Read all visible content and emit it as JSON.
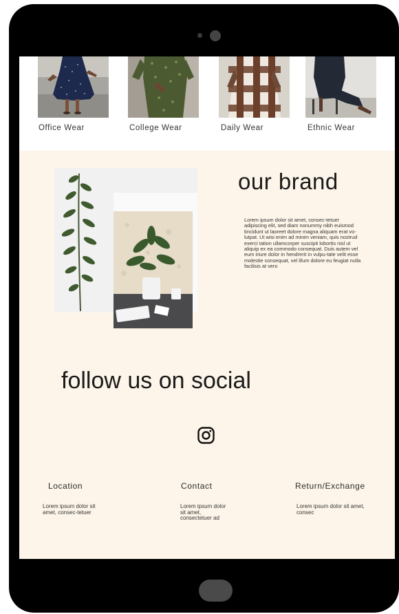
{
  "categories": [
    {
      "label": "Office Wear"
    },
    {
      "label": "College Wear"
    },
    {
      "label": "Daily Wear"
    },
    {
      "label": "Ethnic Wear"
    }
  ],
  "brand": {
    "title": "our brand",
    "body": "Lorem ipsum dolor sit amet, consec-tetuer adipiscing elit, sed diam nonummy nibh euismod tincidunt ut laoreet dolore magna aliquam erat vo-lutpat. Ut wisi enim ad minim veniam, quis nostrud exerci tation ullamcorper suscipit lobortis nisl ut aliquip ex ea commodo consequat. Duis autem vel eum iriure dolor in hendrerit in vulpu-tate velit esse molestie consequat, vel illum dolore eu feugiat nulla facilisis at vero"
  },
  "social": {
    "title": "follow us on social",
    "icon": "instagram-icon"
  },
  "footer": [
    {
      "heading": "Location",
      "text": "Lorem ipsum dolor sit amet, consec-tetuer"
    },
    {
      "heading": "Contact",
      "text": "Lorem ipsum dolor sit amet, consectetuer ad"
    },
    {
      "heading": "Return/Exchange",
      "text": "Lorem ipsum dolor sit amet, consec"
    }
  ],
  "colors": {
    "background": "#fdf5e9",
    "device": "#000000",
    "text": "#1a1a1a"
  }
}
